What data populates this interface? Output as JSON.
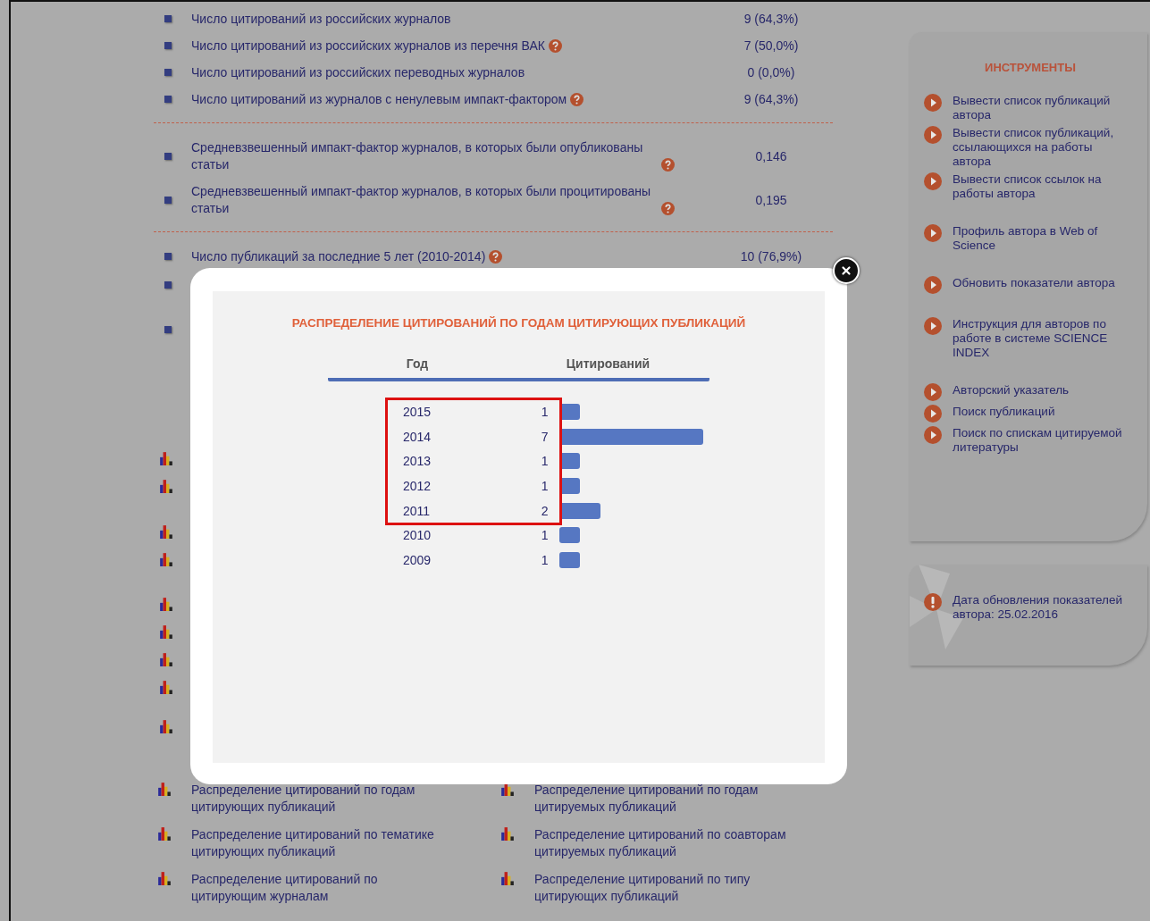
{
  "stats_groups": [
    [
      {
        "label": "Число цитирований из российских журналов",
        "help": false,
        "value": "9 (64,3%)"
      },
      {
        "label": "Число цитирований из российских журналов из перечня ВАК",
        "help": true,
        "value": "7 (50,0%)"
      },
      {
        "label": "Число цитирований из российских переводных журналов",
        "help": false,
        "value": "0 (0,0%)"
      },
      {
        "label": "Число цитирований из журналов с ненулевым импакт-фактором",
        "help": true,
        "value": "9 (64,3%)"
      }
    ],
    [
      {
        "label": "Средневзвешенный импакт-фактор журналов, в которых были опубликованы статьи",
        "help": true,
        "value": "0,146"
      },
      {
        "label": "Средневзвешенный импакт-фактор журналов, в которых были процитированы статьи",
        "help": true,
        "value": "0,195"
      }
    ],
    [
      {
        "label": "Число публикаций за последние 5 лет (2010-2014)",
        "help": true,
        "value": "10 (76,9%)"
      }
    ]
  ],
  "report_links": [
    {
      "label": "Распределение цитирований по годам цитирующих публикаций"
    },
    {
      "label": "Распределение цитирований по годам цитируемых публикаций"
    },
    {
      "label": "Распределение цитирований по тематике цитирующих публикаций"
    },
    {
      "label": "Распределение цитирований по соавторам цитируемых публикаций"
    },
    {
      "label": "Распределение цитирований по цитирующим журналам"
    },
    {
      "label": "Распределение цитирований по типу цитирующих публикаций"
    }
  ],
  "tools": {
    "title": "ИНСТРУМЕНТЫ",
    "items": [
      {
        "label": "Вывести список публикаций автора"
      },
      {
        "label": "Вывести список публикаций, ссылающихся на работы автора"
      },
      {
        "label": "Вывести список ссылок на работы автора"
      },
      {
        "label": "Профиль автора в Web of Science"
      },
      {
        "label": "Обновить показатели автора"
      },
      {
        "label": "Инструкция для авторов по работе в системе SCIENCE INDEX"
      },
      {
        "label": "Авторский указатель"
      },
      {
        "label": "Поиск публикаций"
      },
      {
        "label": "Поиск по спискам цитируемой литературы"
      }
    ]
  },
  "update_notice": {
    "text": "Дата обновления показателей автора: 25.02.2016"
  },
  "modal": {
    "title": "РАСПРЕДЕЛЕНИЕ ЦИТИРОВАНИЙ ПО ГОДАМ ЦИТИРУЮЩИХ ПУБЛИКАЦИЙ",
    "columns": [
      "Год",
      "Цитирований"
    ],
    "row_states": [
      {
        "highlighted": true
      },
      {
        "highlighted": true
      },
      {
        "highlighted": true
      },
      {
        "highlighted": true
      },
      {
        "highlighted": true
      },
      {
        "highlighted": false
      },
      {
        "highlighted": false
      }
    ],
    "chart_data": {
      "type": "bar",
      "orientation": "horizontal",
      "categories": [
        "2015",
        "2014",
        "2013",
        "2012",
        "2011",
        "2010",
        "2009"
      ],
      "values": [
        1,
        7,
        1,
        1,
        2,
        1,
        1
      ],
      "value_labels": [
        "1",
        "7",
        "1",
        "1",
        "2",
        "1",
        "1"
      ]
    }
  }
}
